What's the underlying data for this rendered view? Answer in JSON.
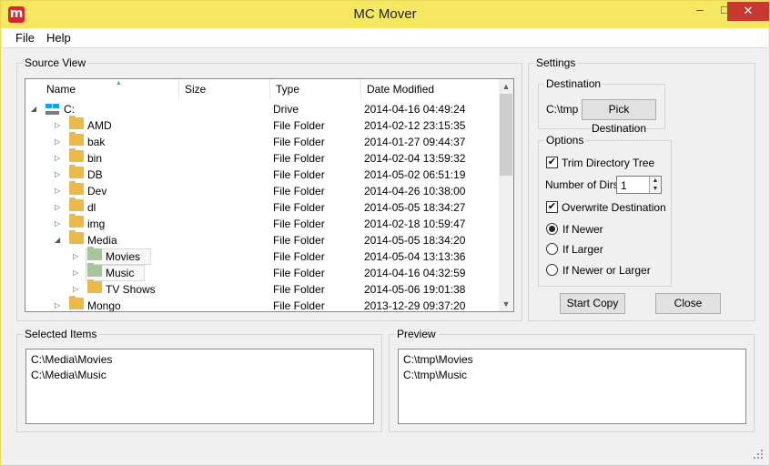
{
  "window": {
    "title": "MC Mover",
    "app_icon": "m",
    "minimize": "–",
    "maximize": "□",
    "close": "✕"
  },
  "menu": [
    "File",
    "Help"
  ],
  "source_view": {
    "title": "Source View",
    "columns": [
      "Name",
      "Size",
      "Type",
      "Date Modified"
    ],
    "rows": [
      {
        "name": "C:",
        "type": "Drive",
        "date": "2014-04-16 04:49:24",
        "icon": "drive-icon",
        "expander": "expanded",
        "level": 0
      },
      {
        "name": "AMD",
        "type": "File Folder",
        "date": "2014-02-12 23:15:35",
        "icon": "folder-icon",
        "expander": "collapsed",
        "level": 1
      },
      {
        "name": "bak",
        "type": "File Folder",
        "date": "2014-01-27 09:44:37",
        "icon": "folder-icon",
        "expander": "collapsed",
        "level": 1
      },
      {
        "name": "bin",
        "type": "File Folder",
        "date": "2014-02-04 13:59:32",
        "icon": "folder-icon",
        "expander": "collapsed",
        "level": 1
      },
      {
        "name": "DB",
        "type": "File Folder",
        "date": "2014-05-02 06:51:19",
        "icon": "folder-icon",
        "expander": "collapsed",
        "level": 1
      },
      {
        "name": "Dev",
        "type": "File Folder",
        "date": "2014-04-26 10:38:00",
        "icon": "folder-icon",
        "expander": "collapsed",
        "level": 1
      },
      {
        "name": "dl",
        "type": "File Folder",
        "date": "2014-05-05 18:34:27",
        "icon": "folder-icon",
        "expander": "collapsed",
        "level": 1
      },
      {
        "name": "img",
        "type": "File Folder",
        "date": "2014-02-18 10:59:47",
        "icon": "folder-icon",
        "expander": "collapsed",
        "level": 1
      },
      {
        "name": "Media",
        "type": "File Folder",
        "date": "2014-05-05 18:34:20",
        "icon": "folder-icon",
        "expander": "expanded",
        "level": 1
      },
      {
        "name": "Movies",
        "type": "File Folder",
        "date": "2014-05-04 13:13:36",
        "icon": "folder-icon",
        "expander": "collapsed",
        "level": 2,
        "selected": true
      },
      {
        "name": "Music",
        "type": "File Folder",
        "date": "2014-04-16 04:32:59",
        "icon": "folder-icon",
        "expander": "collapsed",
        "level": 2,
        "selected": true
      },
      {
        "name": "TV Shows",
        "type": "File Folder",
        "date": "2014-05-06 19:01:38",
        "icon": "folder-icon",
        "expander": "collapsed",
        "level": 2
      },
      {
        "name": "Mongo",
        "type": "File Folder",
        "date": "2013-12-29 09:37:20",
        "icon": "folder-icon",
        "expander": "collapsed",
        "level": 1
      }
    ]
  },
  "settings": {
    "title": "Settings",
    "destination": {
      "title": "Destination",
      "path": "C:\\tmp",
      "pick_label": "Pick Destination"
    },
    "options": {
      "title": "Options",
      "trim_label": "Trim Directory Tree",
      "trim_checked": true,
      "dirs_label": "Number of Dirs",
      "dirs_value": "1",
      "overwrite_label": "Overwrite Destination",
      "overwrite_checked": true,
      "radios": [
        {
          "label": "If Newer",
          "selected": true
        },
        {
          "label": "If Larger",
          "selected": false
        },
        {
          "label": "If Newer or Larger",
          "selected": false
        }
      ]
    },
    "start_label": "Start Copy",
    "close_label": "Close"
  },
  "selected_items": {
    "title": "Selected Items",
    "items": [
      "C:\\Media\\Movies",
      "C:\\Media\\Music"
    ]
  },
  "preview": {
    "title": "Preview",
    "items": [
      "C:\\tmp\\Movies",
      "C:\\tmp\\Music"
    ]
  }
}
